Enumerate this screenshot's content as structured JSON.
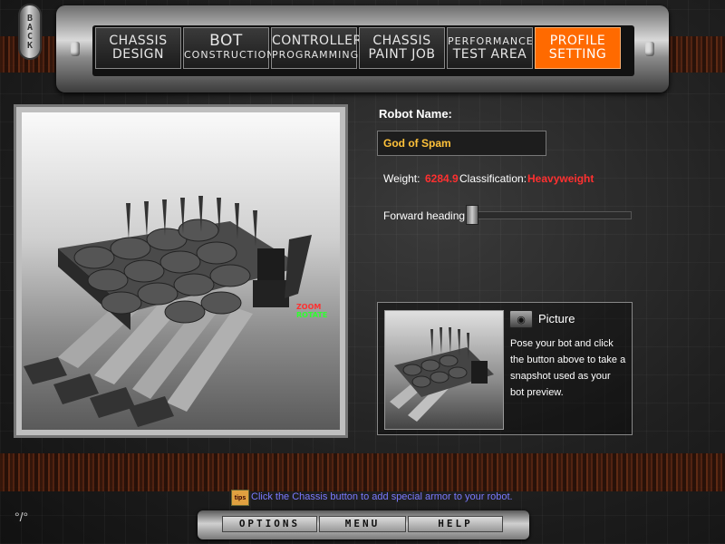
{
  "nav": {
    "back_label": "BACK",
    "tabs": [
      {
        "line1": "CHASSIS",
        "line2": "DESIGN"
      },
      {
        "line1": "BOT",
        "line2": "CONSTRUCTION"
      },
      {
        "line1": "CONTROLLER",
        "line2": "PROGRAMMING"
      },
      {
        "line1": "CHASSIS",
        "line2": "PAINT JOB"
      },
      {
        "line1": "PERFORMANCE",
        "line2": "TEST AREA"
      },
      {
        "line1": "PROFILE",
        "line2": "SETTING"
      }
    ],
    "active_index": 5
  },
  "viewport": {
    "zoom_label": "ZOOM",
    "rotate_label": "ROTATE"
  },
  "robot": {
    "name_label": "Robot Name:",
    "name_value": "God of Spam",
    "weight_label": "Weight:",
    "weight_value": "6284.9",
    "classification_label": "Classification:",
    "classification_value": "Heavyweight",
    "heading_label": "Forward heading:"
  },
  "picture": {
    "title": "Picture",
    "description": "Pose your bot and click the button above to take a snapshot used as your bot preview.",
    "camera_icon": "camera-icon"
  },
  "tip": {
    "icon_label": "tips",
    "text": "Click the Chassis button to add special armor to your robot."
  },
  "bottom_menu": {
    "options": "OPTIONS",
    "menu": "MENU",
    "help": "HELP"
  },
  "colors": {
    "active_tab": "#ff6a00",
    "name_text": "#ffc23a",
    "stat_value": "#ff3030",
    "tip_text": "#7a7aff"
  }
}
